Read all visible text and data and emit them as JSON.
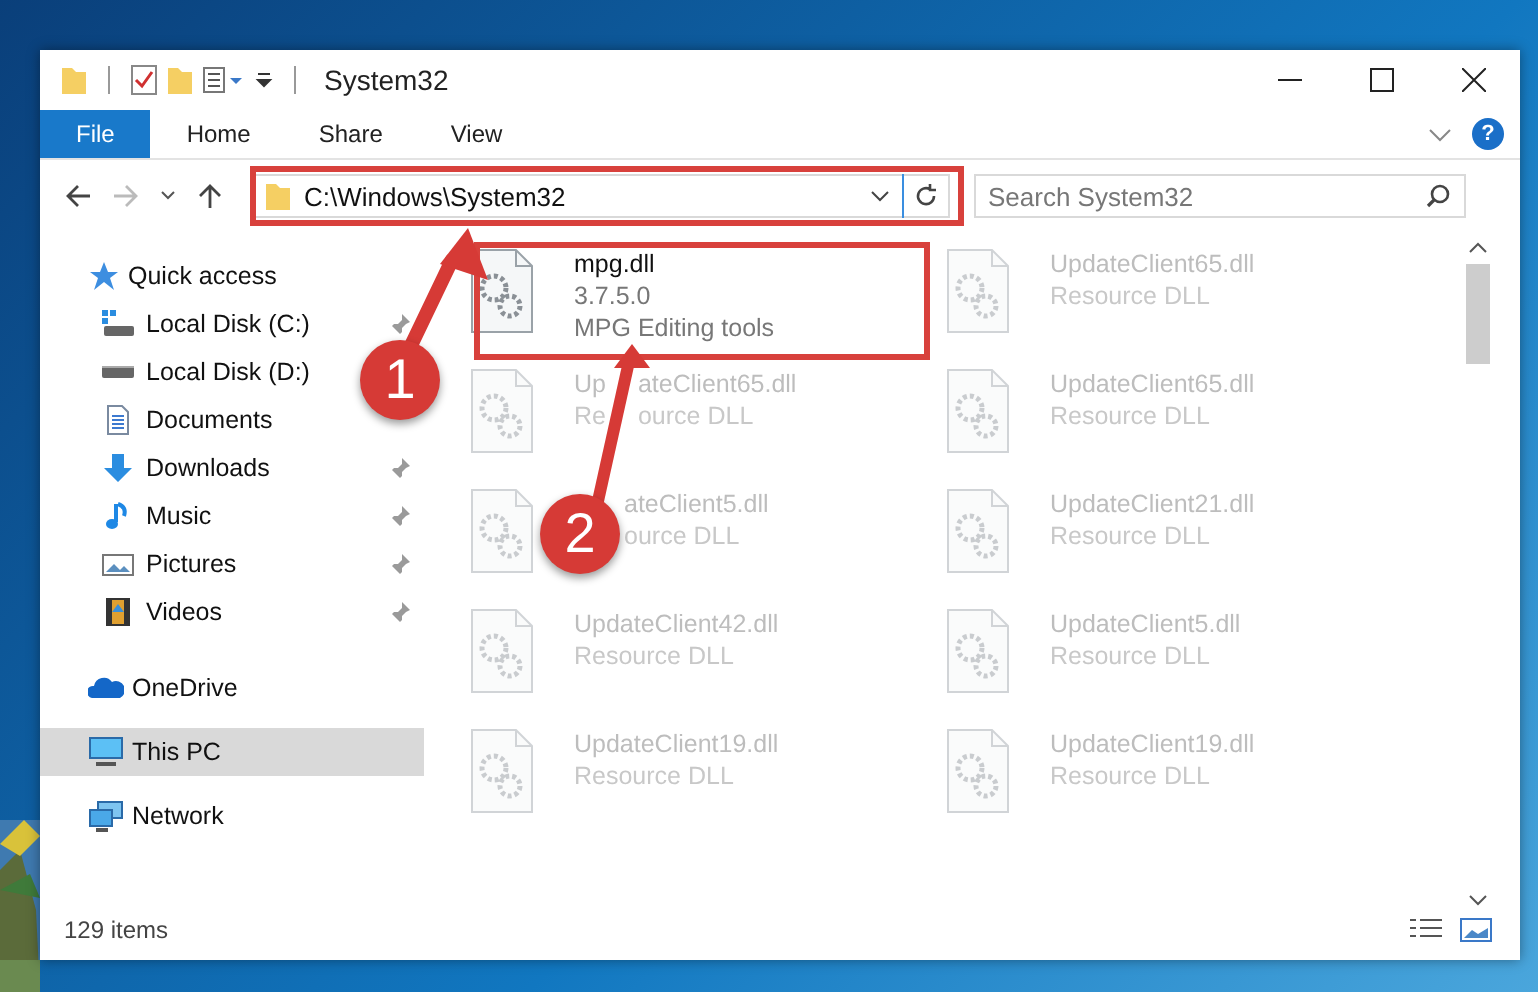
{
  "window": {
    "title": "System32"
  },
  "ribbon_tabs": [
    {
      "label": "File",
      "selected": true
    },
    {
      "label": "Home",
      "selected": false
    },
    {
      "label": "Share",
      "selected": false
    },
    {
      "label": "View",
      "selected": false
    }
  ],
  "help": "?",
  "address": {
    "path": "C:\\Windows\\System32"
  },
  "search": {
    "placeholder": "Search System32"
  },
  "sidebar": {
    "items": [
      {
        "label": "Quick access",
        "kind": "star",
        "selected": false,
        "children": [
          {
            "label": "Local Disk (C:)",
            "kind": "system-drive",
            "pinned": true,
            "selected": false
          },
          {
            "label": "Local Disk (D:)",
            "kind": "drive",
            "pinned": false,
            "selected": false
          },
          {
            "label": "Documents",
            "kind": "documents",
            "pinned": false,
            "selected": false
          },
          {
            "label": "Downloads",
            "kind": "downloads",
            "pinned": true,
            "selected": false
          },
          {
            "label": "Music",
            "kind": "music",
            "pinned": true,
            "selected": false
          },
          {
            "label": "Pictures",
            "kind": "pictures",
            "pinned": true,
            "selected": false
          },
          {
            "label": "Videos",
            "kind": "videos",
            "pinned": true,
            "selected": false
          }
        ]
      },
      {
        "label": "OneDrive",
        "kind": "cloud",
        "selected": false
      },
      {
        "label": "This PC",
        "kind": "pc",
        "selected": true
      },
      {
        "label": "Network",
        "kind": "network",
        "selected": false
      }
    ]
  },
  "files": [
    {
      "name": "mpg.dll",
      "version": "3.7.5.0",
      "description": "MPG Editing tools",
      "blurred": false
    },
    {
      "name": "UpdateClient65.dll",
      "description": "Resource DLL",
      "blurred": true
    },
    {
      "kind": "behind-arrow",
      "name_parts": [
        "Up",
        "ateClient65.dll"
      ],
      "description_parts": [
        "Re",
        "ource DLL"
      ],
      "blurred": true
    },
    {
      "name": "UpdateClient65.dll",
      "description": "Resource DLL",
      "blurred": true
    },
    {
      "kind": "behind-badge",
      "name_parts": [
        "ateClient5.dll"
      ],
      "description_parts": [
        "ource DLL"
      ],
      "blurred": true
    },
    {
      "name": "UpdateClient21.dll",
      "description": "Resource DLL",
      "blurred": true
    },
    {
      "name": "UpdateClient42.dll",
      "description": "Resource DLL",
      "blurred": true
    },
    {
      "name": "UpdateClient5.dll",
      "description": "Resource DLL",
      "blurred": true
    },
    {
      "name": "UpdateClient19.dll",
      "description": "Resource DLL",
      "blurred": true
    },
    {
      "name": "UpdateClient19.dll",
      "description": "Resource DLL",
      "blurred": true
    }
  ],
  "status_bar": {
    "count": "129 items"
  },
  "annotations": [
    {
      "label": "1"
    },
    {
      "label": "2"
    }
  ]
}
